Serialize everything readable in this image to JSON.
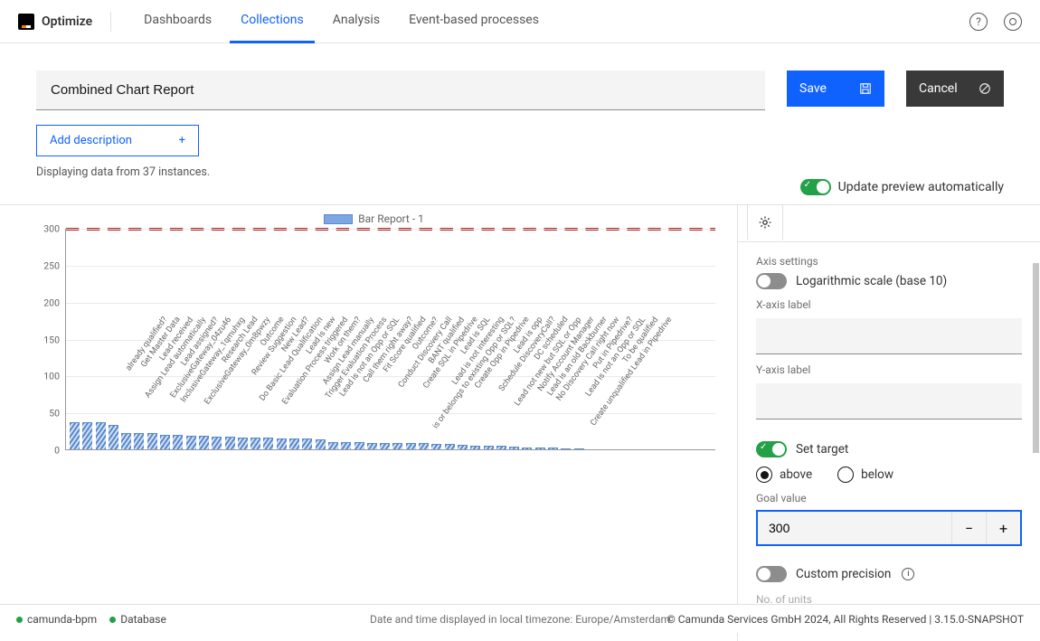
{
  "app": {
    "name": "Optimize"
  },
  "nav": {
    "items": [
      {
        "label": "Dashboards",
        "active": false
      },
      {
        "label": "Collections",
        "active": true
      },
      {
        "label": "Analysis",
        "active": false
      },
      {
        "label": "Event-based processes",
        "active": false
      }
    ]
  },
  "report": {
    "title": "Combined Chart Report",
    "add_description_label": "Add description",
    "instances_note": "Displaying data from 37 instances."
  },
  "actions": {
    "save": "Save",
    "cancel": "Cancel"
  },
  "preview": {
    "auto_update_label": "Update preview automatically",
    "auto_update_on": true
  },
  "chart_data": {
    "type": "bar",
    "legend": "Bar Report - 1",
    "ylim": [
      0,
      300
    ],
    "yticks": [
      0,
      50,
      100,
      150,
      200,
      250,
      300
    ],
    "goal_value": 300,
    "categories": [
      "already qualified?",
      "Get Master Data",
      "Lead received",
      "Assign Lead automatically",
      "Lead assigned?",
      "ExclusiveGateway_04zu46",
      "InclusiveGateway_1qmuhxg",
      "Research Lead",
      "ExclusiveGateway_0m8pwzy",
      "Outcome",
      "Review Suggestion",
      "New Lead?",
      "Do Basic Lead Qualification",
      "Lead is new",
      "Evaluation Process triggered",
      "Work on them?",
      "Assign Lead manually",
      "Trigger Evaluation Process",
      "Lead is not an Opp or SQL",
      "Call them right away?",
      "Fit Score qualified",
      "Outcome?",
      "Conduct Discovery Call",
      "BANT qualified",
      "Create SQL in Pipedrive",
      "Lead is SQL",
      "Lead is not interesting",
      "is or belongs to existing Opp or SQL?",
      "Create Opp in Pipedrive",
      "Lead is opp",
      "Schedule DiscoveryCall?",
      "DC scheduled",
      "Lead not new but SQL or Opp",
      "Notify Account Manager",
      "Lead is an old Backburner",
      "No Discovery Call right now",
      "Put in Pipedrive?",
      "Lead is not an Opp or SQL",
      "To be qualified",
      "Create unqualified Lead in Pipedrive"
    ],
    "values": [
      37,
      37,
      37,
      33,
      22,
      22,
      22,
      20,
      20,
      18,
      18,
      17,
      17,
      16,
      16,
      16,
      15,
      15,
      15,
      14,
      10,
      10,
      10,
      9,
      9,
      9,
      8,
      8,
      7,
      7,
      6,
      5,
      5,
      5,
      4,
      3,
      2,
      2,
      1,
      0
    ]
  },
  "settings": {
    "axis_section": "Axis settings",
    "log_scale_label": "Logarithmic scale (base 10)",
    "log_scale_on": false,
    "x_axis_label_caption": "X-axis label",
    "x_axis_label_value": "",
    "y_axis_label_caption": "Y-axis label",
    "y_axis_label_value": "",
    "set_target_label": "Set target",
    "set_target_on": true,
    "target_mode": "above",
    "above_label": "above",
    "below_label": "below",
    "goal_value_caption": "Goal value",
    "goal_value": "300",
    "custom_precision_label": "Custom precision",
    "custom_precision_on": false,
    "cutoff_label": "No. of units"
  },
  "footer": {
    "engine": "camunda-bpm",
    "database": "Database",
    "timezone_note": "Date and time displayed in local timezone: Europe/Amsterdam",
    "copyright": "© Camunda Services GmbH 2024, All Rights Reserved | 3.15.0-SNAPSHOT"
  }
}
